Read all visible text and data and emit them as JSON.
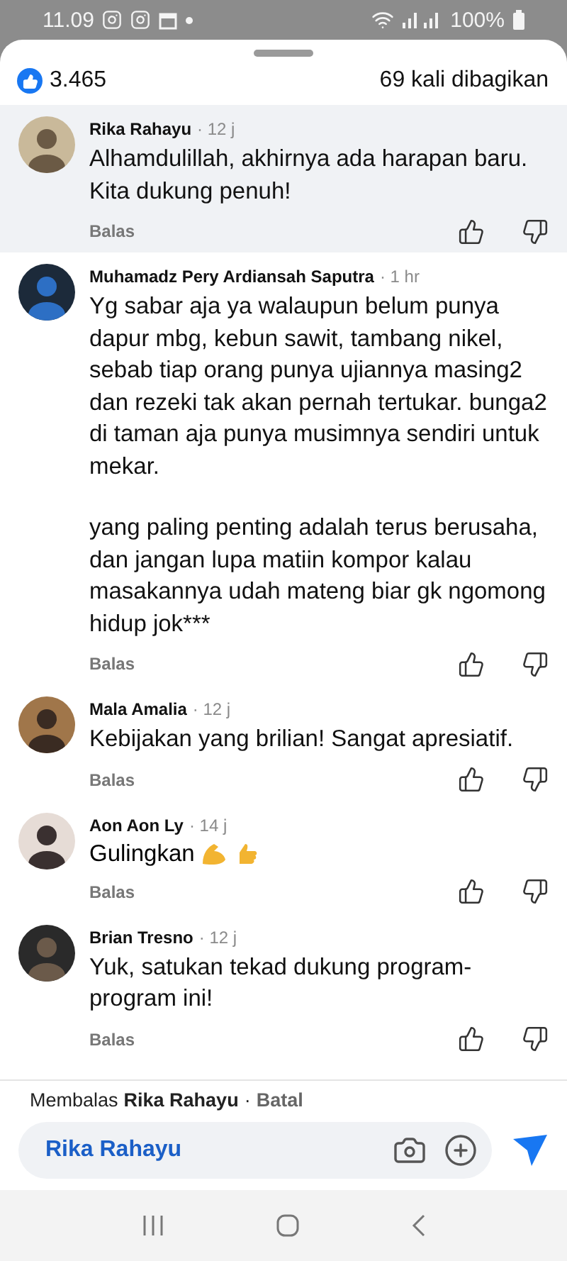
{
  "status_bar": {
    "time": "11.09",
    "battery": "100%"
  },
  "reactions": {
    "count": "3.465",
    "shares": "69 kali dibagikan"
  },
  "comments": [
    {
      "name": "Rika Rahayu",
      "time": "· 12 j",
      "paragraphs": [
        "Alhamdulillah, akhirnya ada harapan baru. Kita dukung penuh!"
      ],
      "highlighted": true,
      "emoji": false,
      "reply": "Balas"
    },
    {
      "name": "Muhamadz Pery Ardiansah Saputra",
      "time": "· 1 hr",
      "paragraphs": [
        "Yg sabar aja ya walaupun belum punya dapur mbg, kebun sawit, tambang nikel, sebab tiap orang punya ujiannya masing2 dan rezeki tak akan pernah tertukar. bunga2 di taman aja punya musimnya sendiri untuk mekar.",
        "yang paling penting adalah terus berusaha, dan jangan lupa matiin kompor kalau masakannya udah mateng biar gk ngomong hidup jok***"
      ],
      "highlighted": false,
      "emoji": false,
      "reply": "Balas"
    },
    {
      "name": "Mala Amalia",
      "time": "· 12 j",
      "paragraphs": [
        "Kebijakan yang brilian! Sangat apresiatif."
      ],
      "highlighted": false,
      "emoji": false,
      "reply": "Balas"
    },
    {
      "name": "Aon Aon Ly",
      "time": "· 14 j",
      "paragraphs": [
        "Gulingkan"
      ],
      "highlighted": false,
      "emoji": true,
      "reply": "Balas"
    },
    {
      "name": "Brian Tresno",
      "time": "· 12 j",
      "paragraphs": [
        "Yuk, satukan tekad dukung program-program ini!"
      ],
      "highlighted": false,
      "emoji": false,
      "reply": "Balas"
    }
  ],
  "reply_bar": {
    "prefix": "Membalas",
    "name": "Rika Rahayu",
    "separator": "·",
    "cancel": "Batal",
    "input_value": "Rika Rahayu"
  }
}
